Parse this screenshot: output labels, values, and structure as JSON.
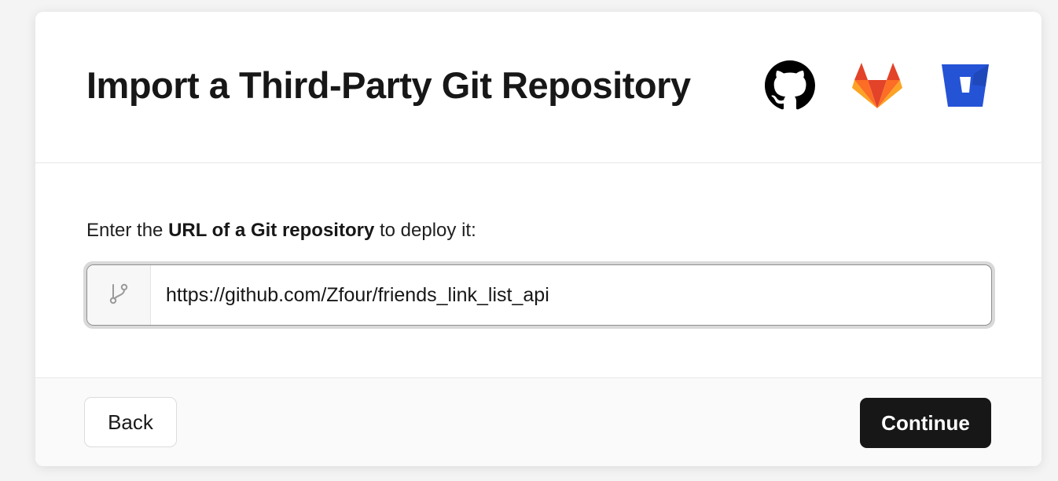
{
  "dialog": {
    "title": "Import a Third-Party Git Repository",
    "providers": [
      {
        "name": "GitHub",
        "icon": "github-icon",
        "color": "#000000"
      },
      {
        "name": "GitLab",
        "icon": "gitlab-icon",
        "colors": [
          "#e24329",
          "#fc6d26",
          "#fca326"
        ]
      },
      {
        "name": "Bitbucket",
        "icon": "bitbucket-icon",
        "color": "#2553d6"
      }
    ]
  },
  "prompt": {
    "prefix": "Enter the ",
    "bold": "URL of a Git repository",
    "suffix": " to deploy it:"
  },
  "url_field": {
    "icon": "git-branch-icon",
    "value": "https://github.com/Zfour/friends_link_list_api"
  },
  "footer": {
    "back_label": "Back",
    "continue_label": "Continue"
  }
}
